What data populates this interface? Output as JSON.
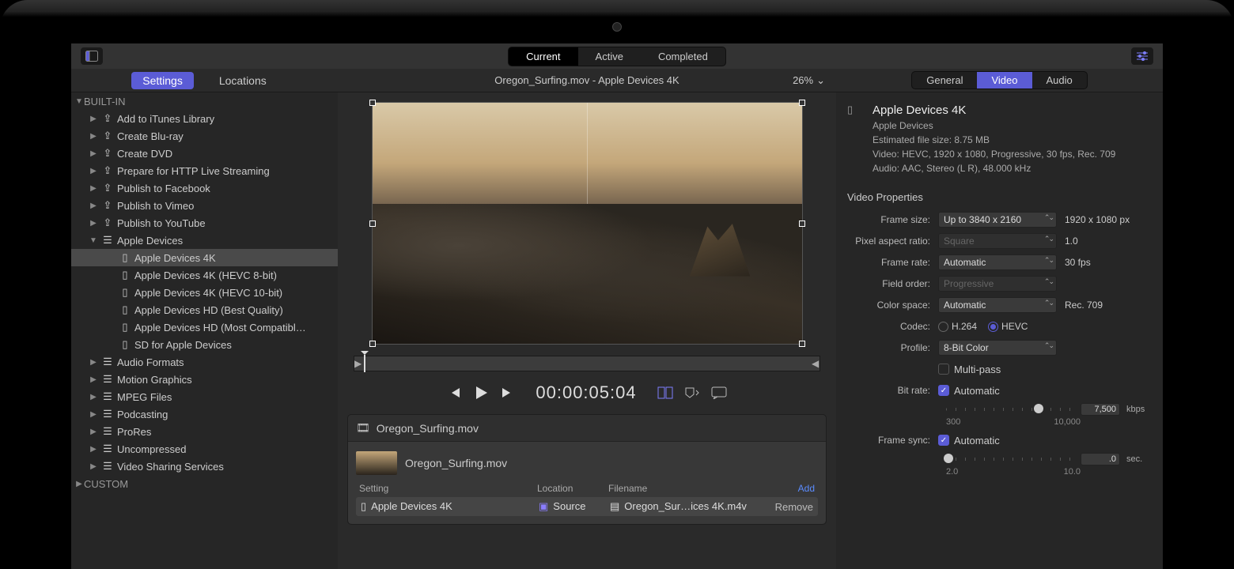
{
  "toolbar": {
    "tabs": {
      "current": "Current",
      "active": "Active",
      "completed": "Completed",
      "selected": "current"
    }
  },
  "leftTabs": {
    "settings": "Settings",
    "locations": "Locations",
    "selected": "settings"
  },
  "centerTitle": "Oregon_Surfing.mov - Apple Devices 4K",
  "zoomLevel": "26%",
  "inspectorTabs": {
    "general": "General",
    "video": "Video",
    "audio": "Audio",
    "selected": "video"
  },
  "sidebar": {
    "builtIn": {
      "label": "BUILT-IN",
      "items": [
        {
          "label": "Add to iTunes Library",
          "icon": "share"
        },
        {
          "label": "Create Blu-ray",
          "icon": "share"
        },
        {
          "label": "Create DVD",
          "icon": "share"
        },
        {
          "label": "Prepare for HTTP Live Streaming",
          "icon": "share"
        },
        {
          "label": "Publish to Facebook",
          "icon": "share"
        },
        {
          "label": "Publish to Vimeo",
          "icon": "share"
        },
        {
          "label": "Publish to YouTube",
          "icon": "share"
        },
        {
          "label": "Apple Devices",
          "icon": "devices",
          "expanded": true,
          "children": [
            {
              "label": "Apple Devices 4K",
              "selected": true
            },
            {
              "label": "Apple Devices 4K (HEVC 8-bit)"
            },
            {
              "label": "Apple Devices 4K (HEVC 10-bit)"
            },
            {
              "label": "Apple Devices HD (Best Quality)"
            },
            {
              "label": "Apple Devices HD (Most Compatibl…"
            },
            {
              "label": "SD for Apple Devices"
            }
          ]
        },
        {
          "label": "Audio Formats",
          "icon": "preset"
        },
        {
          "label": "Motion Graphics",
          "icon": "preset"
        },
        {
          "label": "MPEG Files",
          "icon": "preset"
        },
        {
          "label": "Podcasting",
          "icon": "preset"
        },
        {
          "label": "ProRes",
          "icon": "preset"
        },
        {
          "label": "Uncompressed",
          "icon": "preset"
        },
        {
          "label": "Video Sharing Services",
          "icon": "preset"
        }
      ]
    },
    "custom": {
      "label": "CUSTOM"
    }
  },
  "transport": {
    "timecode": "00:00:05:04"
  },
  "batch": {
    "sourceName": "Oregon_Surfing.mov",
    "rowSourceName": "Oregon_Surfing.mov",
    "headers": {
      "setting": "Setting",
      "location": "Location",
      "filename": "Filename",
      "add": "Add"
    },
    "row": {
      "setting": "Apple Devices 4K",
      "location": "Source",
      "filename": "Oregon_Sur…ices 4K.m4v",
      "remove": "Remove"
    }
  },
  "inspector": {
    "title": "Apple Devices 4K",
    "subtitle": "Apple Devices",
    "fileSizeLine": "Estimated file size: 8.75 MB",
    "videoLine": "Video: HEVC, 1920 x 1080, Progressive, 30 fps, Rec. 709",
    "audioLine": "Audio: AAC, Stereo (L R), 48.000 kHz",
    "sectionTitle": "Video Properties",
    "props": {
      "frameSize": {
        "label": "Frame size:",
        "value": "Up to 3840 x 2160",
        "readout": "1920 x 1080 px"
      },
      "par": {
        "label": "Pixel aspect ratio:",
        "value": "Square",
        "readout": "1.0"
      },
      "frameRate": {
        "label": "Frame rate:",
        "value": "Automatic",
        "readout": "30 fps"
      },
      "fieldOrder": {
        "label": "Field order:",
        "value": "Progressive"
      },
      "colorSpace": {
        "label": "Color space:",
        "value": "Automatic",
        "readout": "Rec. 709"
      },
      "codec": {
        "label": "Codec:",
        "h264": "H.264",
        "hevc": "HEVC",
        "selected": "hevc"
      },
      "profile": {
        "label": "Profile:",
        "value": "8-Bit Color"
      },
      "multipass": {
        "label": "Multi-pass",
        "checked": false
      },
      "bitRate": {
        "label": "Bit rate:",
        "auto": "Automatic",
        "checked": true,
        "value": "7,500",
        "unit": "kbps",
        "min": "300",
        "max": "10,000",
        "pos": 72
      },
      "frameSync": {
        "label": "Frame sync:",
        "auto": "Automatic",
        "checked": true,
        "value": ".0",
        "unit": "sec.",
        "min": "2.0",
        "max": "10.0",
        "pos": 2
      }
    }
  }
}
